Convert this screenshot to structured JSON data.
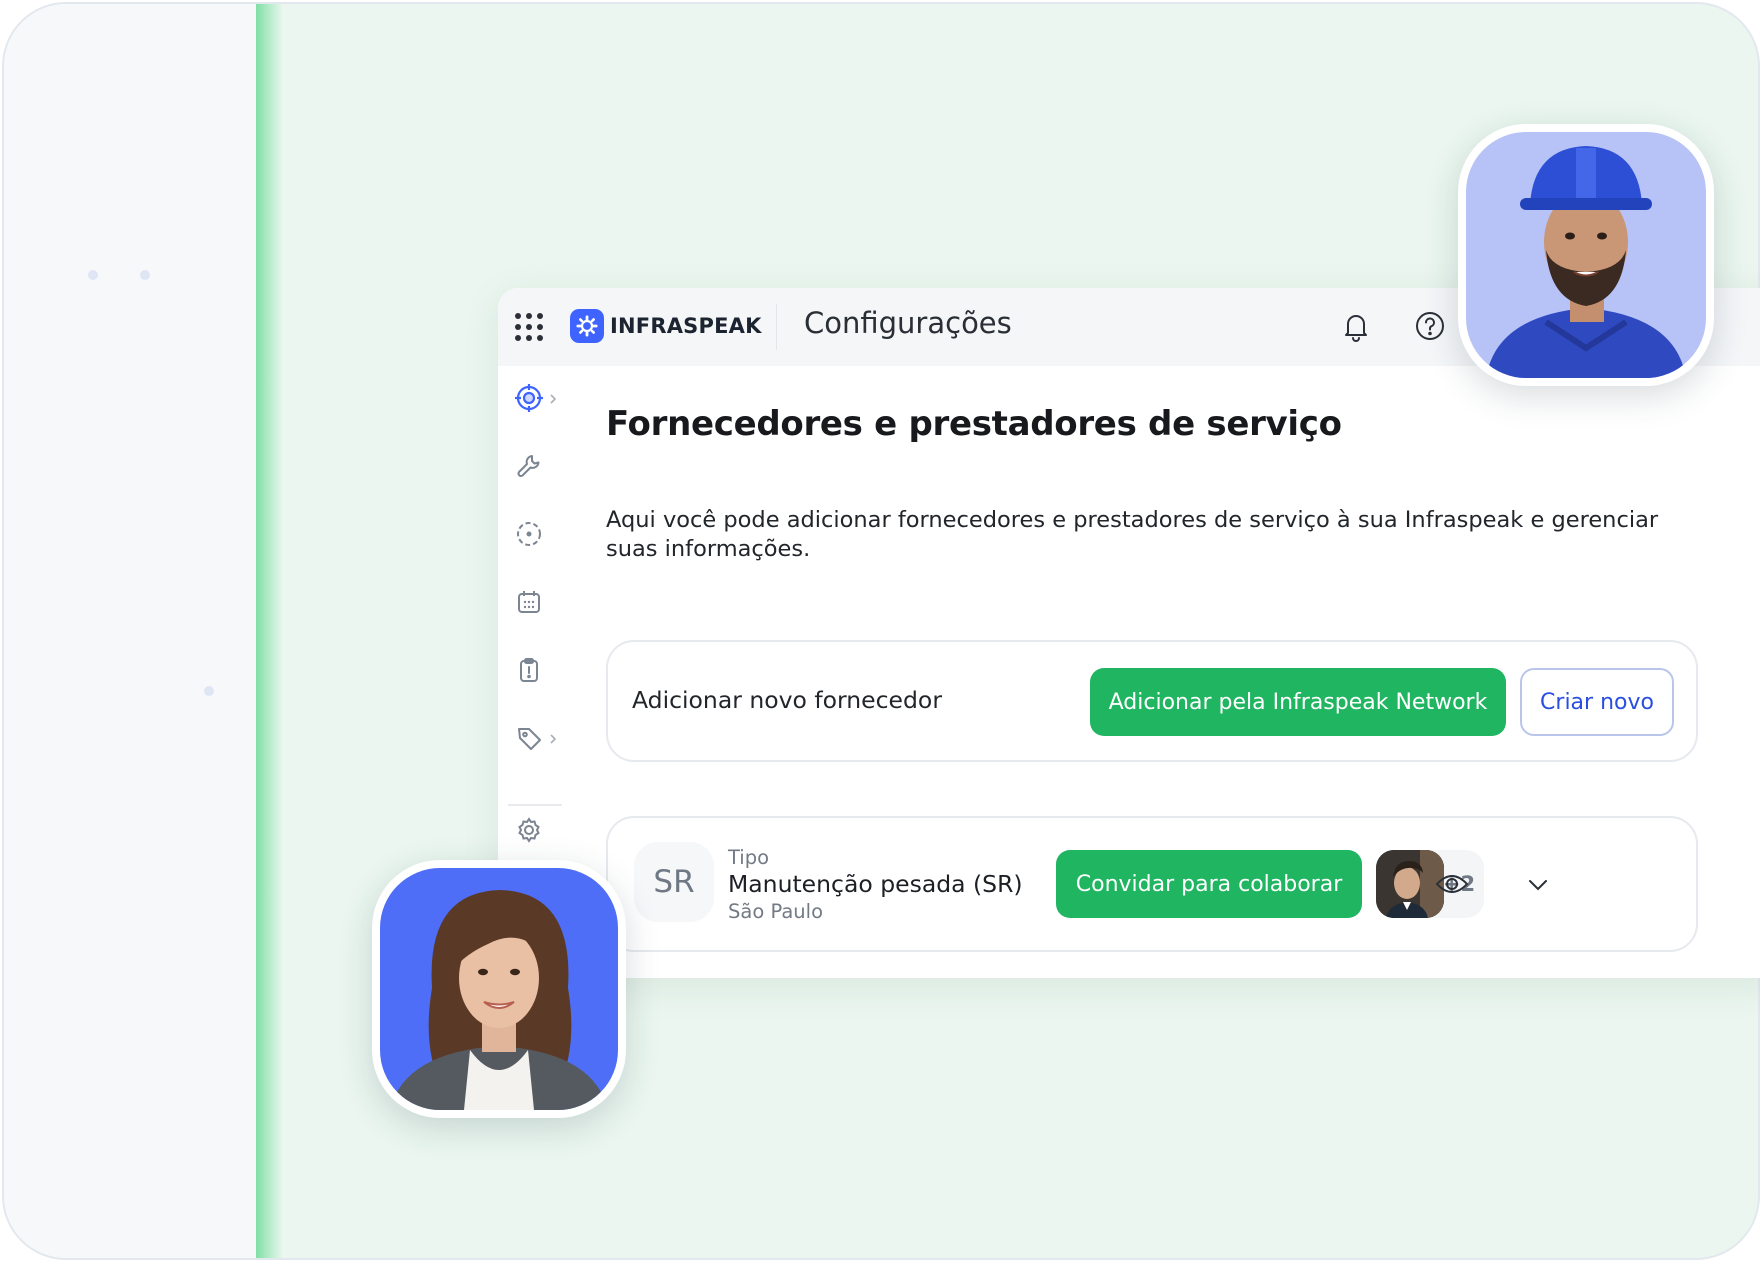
{
  "header": {
    "brand": "INFRASPEAK",
    "section": "Configurações"
  },
  "main": {
    "title": "Fornecedores e prestadores de serviço",
    "description": "Aqui você pode adicionar fornecedores e prestadores de serviço à sua Infraspeak e gerenciar suas informações."
  },
  "add_card": {
    "label": "Adicionar novo fornecedor",
    "network_button": "Adicionar pela Infraspeak Network",
    "create_button": "Criar novo"
  },
  "supplier": {
    "initials": "SR",
    "type_label": "Tipo",
    "type_value": "Manutenção pesada (SR)",
    "city": "São Paulo",
    "invite_button": "Convidar para colaborar",
    "extra_count": "+2"
  },
  "colors": {
    "accent_green": "#1fb561",
    "brand_blue": "#3f63ff",
    "link_blue": "#2a4fe0"
  },
  "icons": {
    "apps": "grid-icon",
    "notifications": "bell-icon",
    "help": "help-icon",
    "view": "eye-icon",
    "expand": "chevron-down-icon"
  }
}
